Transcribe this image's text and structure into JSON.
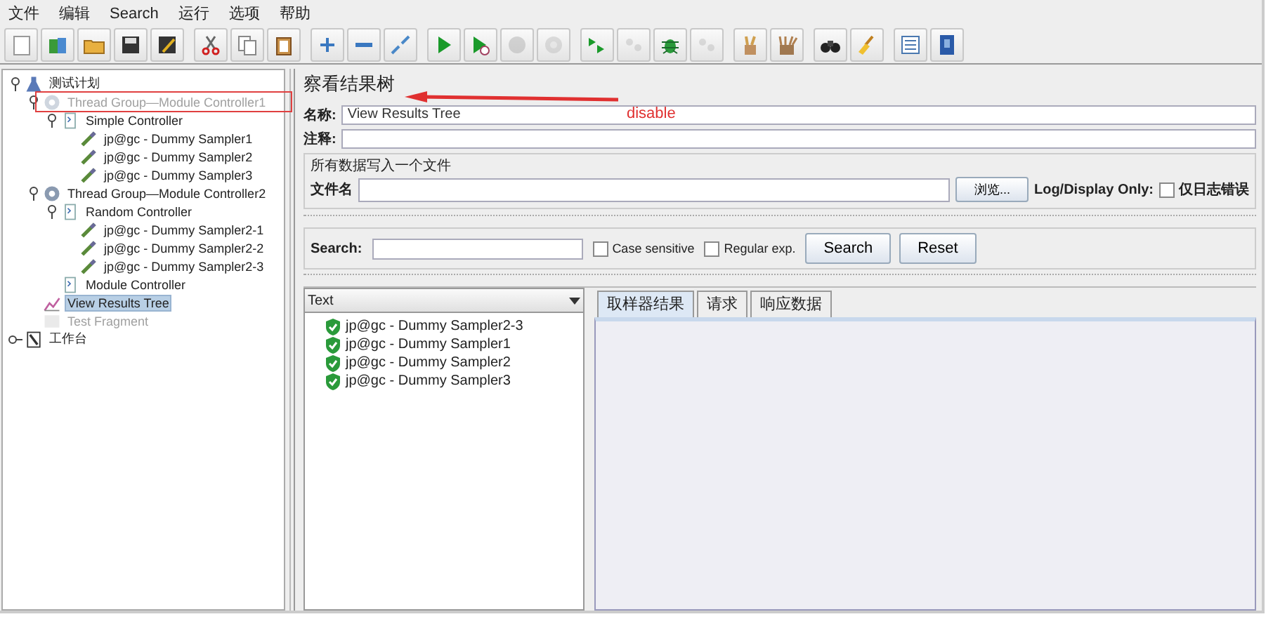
{
  "menu": [
    "文件",
    "编辑",
    "Search",
    "运行",
    "选项",
    "帮助"
  ],
  "toolbar": [
    [
      {
        "disabled": false
      },
      {
        "disabled": false
      },
      {
        "disabled": false
      },
      {
        "disabled": false
      },
      {
        "disabled": false
      }
    ],
    [
      {
        "disabled": false
      },
      {
        "disabled": false
      },
      {
        "disabled": false
      }
    ],
    [
      {
        "disabled": false
      },
      {
        "disabled": false
      },
      {
        "disabled": false
      }
    ],
    [
      {
        "disabled": false
      },
      {
        "disabled": false
      },
      {
        "disabled": true
      },
      {
        "disabled": true
      }
    ],
    [
      {
        "disabled": false
      },
      {
        "disabled": true
      },
      {
        "disabled": false
      },
      {
        "disabled": true
      }
    ],
    [
      {
        "disabled": false
      },
      {
        "disabled": false
      }
    ],
    [
      {
        "disabled": false
      },
      {
        "disabled": false
      }
    ],
    [
      {
        "disabled": false
      },
      {
        "disabled": false
      }
    ]
  ],
  "tree": [
    {
      "label": "测试计划",
      "kind": "plan",
      "expanded": true,
      "disabled": false,
      "selected": false,
      "children": [
        {
          "label": "Thread Group—Module Controller1",
          "kind": "thread-group",
          "expanded": true,
          "disabled": true,
          "selected": false,
          "children": [
            {
              "label": "Simple Controller",
              "kind": "controller",
              "expanded": true,
              "disabled": false,
              "selected": false,
              "children": [
                {
                  "label": "jp@gc - Dummy Sampler1",
                  "kind": "sampler",
                  "disabled": false,
                  "selected": false
                },
                {
                  "label": "jp@gc - Dummy Sampler2",
                  "kind": "sampler",
                  "disabled": false,
                  "selected": false
                },
                {
                  "label": "jp@gc - Dummy Sampler3",
                  "kind": "sampler",
                  "disabled": false,
                  "selected": false
                }
              ]
            }
          ]
        },
        {
          "label": "Thread Group—Module Controller2",
          "kind": "thread-group",
          "expanded": true,
          "disabled": false,
          "selected": false,
          "children": [
            {
              "label": "Random Controller",
              "kind": "controller",
              "expanded": true,
              "disabled": false,
              "selected": false,
              "children": [
                {
                  "label": "jp@gc - Dummy Sampler2-1",
                  "kind": "sampler",
                  "disabled": false,
                  "selected": false
                },
                {
                  "label": "jp@gc - Dummy Sampler2-2",
                  "kind": "sampler",
                  "disabled": false,
                  "selected": false
                },
                {
                  "label": "jp@gc - Dummy Sampler2-3",
                  "kind": "sampler",
                  "disabled": false,
                  "selected": false
                }
              ]
            },
            {
              "label": "Module Controller",
              "kind": "controller",
              "disabled": false,
              "selected": false
            }
          ]
        },
        {
          "label": "View Results Tree",
          "kind": "listener",
          "disabled": false,
          "selected": true
        },
        {
          "label": "Test Fragment",
          "kind": "fragment",
          "disabled": true,
          "selected": false
        }
      ]
    },
    {
      "label": "工作台",
      "kind": "workbench",
      "expanded": false,
      "disabled": false,
      "selected": false
    }
  ],
  "annotation": {
    "label": "disable"
  },
  "panel": {
    "title": "察看结果树",
    "name_label": "名称:",
    "name_value": "View Results Tree",
    "comment_label": "注释:",
    "file_section": "所有数据写入一个文件",
    "file_label": "文件名",
    "browse_button": "浏览...",
    "log_label": "Log/Display Only:",
    "errors_only": {
      "label": "仅日志错误",
      "checked": false
    },
    "search": {
      "label": "Search:",
      "case_sensitive": {
        "label": "Case sensitive",
        "checked": false
      },
      "regex": {
        "label": "Regular exp.",
        "checked": false
      },
      "buttons": [
        "Search",
        "Reset"
      ]
    },
    "renderer": "Text",
    "results": [
      {
        "label": "jp@gc - Dummy Sampler2-3"
      },
      {
        "label": "jp@gc - Dummy Sampler1"
      },
      {
        "label": "jp@gc - Dummy Sampler2"
      },
      {
        "label": "jp@gc - Dummy Sampler3"
      }
    ],
    "tabs": [
      {
        "label": "取样器结果",
        "selected": true
      },
      {
        "label": "请求",
        "selected": false
      },
      {
        "label": "响应数据",
        "selected": false
      }
    ]
  }
}
